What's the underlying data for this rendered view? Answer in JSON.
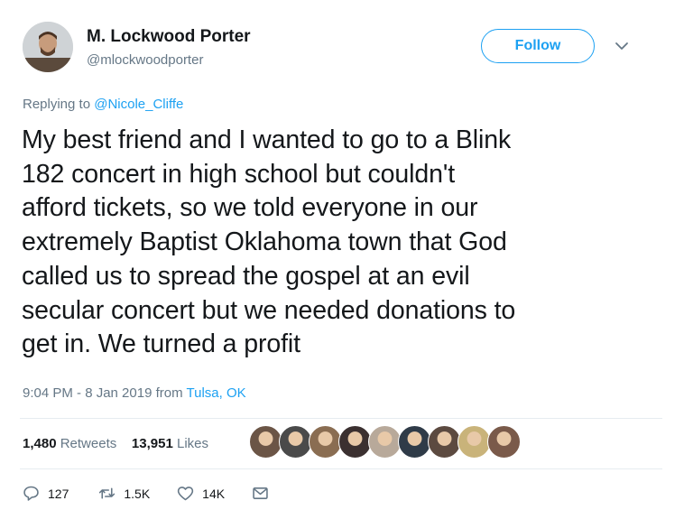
{
  "author": {
    "name": "M. Lockwood Porter",
    "handle": "@mlockwoodporter"
  },
  "follow_label": "Follow",
  "replying": {
    "prefix": "Replying to ",
    "mention": "@Nicole_Cliffe"
  },
  "tweet_text": "My best friend and I wanted to go to a Blink\n182 concert in high school but couldn't\nafford tickets, so we told everyone in our\nextremely Baptist Oklahoma town that God\ncalled us to spread the gospel at an evil\nsecular concert but we needed donations to\nget in. We turned a profit",
  "meta": {
    "time": "9:04 PM - 8 Jan 2019 from ",
    "place": "Tulsa, OK"
  },
  "stats": {
    "retweets_count": "1,480",
    "retweets_label": "Retweets",
    "likes_count": "13,951",
    "likes_label": "Likes"
  },
  "liker_colors": [
    "#6b5546",
    "#4a4a4a",
    "#8a6d52",
    "#3b3030",
    "#b8a99a",
    "#2f3b48",
    "#5c4a40",
    "#c9b37a",
    "#7a5a4a"
  ],
  "actions": {
    "replies": "127",
    "retweets": "1.5K",
    "likes": "14K"
  },
  "colors": {
    "accent": "#1da1f2",
    "secondary_text": "#657786"
  }
}
